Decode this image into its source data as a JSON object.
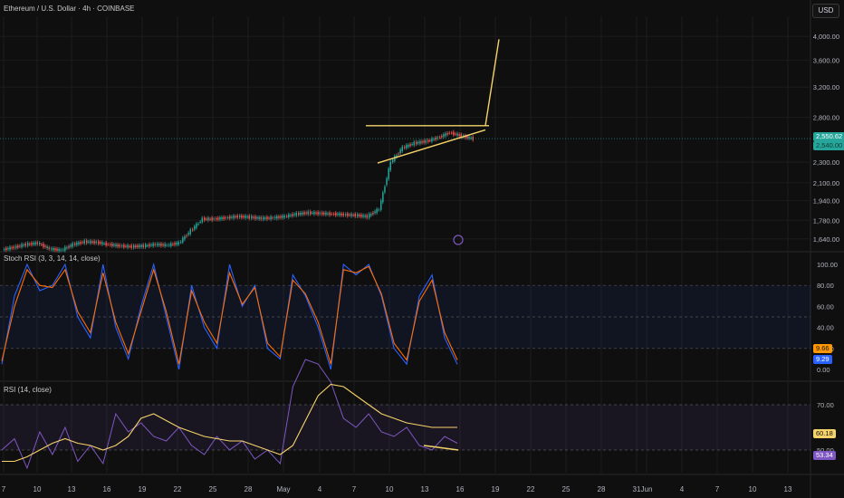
{
  "header": {
    "title": "Ethereum / U.S. Dollar · 4h · COINBASE",
    "currency_button": "USD"
  },
  "colors": {
    "background": "#0f0f0f",
    "grid": "#1c1c1c",
    "candle_up": "#26a69a",
    "candle_down": "#ef5350",
    "drawing": "#f5d36a",
    "stoch_k": "#2962ff",
    "stoch_d": "#ff6d00",
    "rsi": "#7e57c2",
    "rsi_ma": "#f5d36a",
    "price_line": "#26a69a"
  },
  "x_axis": {
    "labels": [
      "7",
      "10",
      "13",
      "16",
      "19",
      "22",
      "25",
      "28",
      "May",
      "4",
      "7",
      "10",
      "13",
      "16",
      "19",
      "22",
      "25",
      "28",
      "31",
      "Jun",
      "4",
      "7",
      "10",
      "13"
    ]
  },
  "price_axis": {
    "ticks": [
      "4,000.00",
      "3,600.00",
      "3,200.00",
      "2,800.00",
      "2,300.00",
      "2,100.00",
      "1,940.00",
      "1,780.00",
      "1,640.00"
    ],
    "current_price": "2,550.62",
    "current_sub": "2,540.00"
  },
  "stoch_rsi": {
    "label": "Stoch RSI (3, 3, 14, 14, close)",
    "ticks": [
      "100.00",
      "80.00",
      "60.00",
      "40.00",
      "20.00",
      "0.00"
    ],
    "k_value": "9.66",
    "d_value": "9.29"
  },
  "rsi": {
    "label": "RSI (14, close)",
    "ticks": [
      "70.00",
      "50.00"
    ],
    "value": "60.18",
    "ma_value": "53.34"
  },
  "chart_data": [
    {
      "type": "candlestick",
      "title": "Ethereum / U.S. Dollar · 4h · COINBASE",
      "y_scale": "log",
      "ylim": [
        1600,
        4200
      ],
      "series": [
        {
          "points": [
            [
              "Apr 7",
              1580
            ],
            [
              "Apr 8",
              1600
            ],
            [
              "Apr 9",
              1610
            ],
            [
              "Apr 10",
              1570
            ],
            [
              "Apr 11",
              1560
            ],
            [
              "Apr 12",
              1600
            ],
            [
              "Apr 13",
              1620
            ],
            [
              "Apr 14",
              1615
            ],
            [
              "Apr 15",
              1600
            ],
            [
              "Apr 16",
              1590
            ],
            [
              "Apr 17",
              1585
            ],
            [
              "Apr 18",
              1590
            ],
            [
              "Apr 19",
              1600
            ],
            [
              "Apr 20",
              1595
            ],
            [
              "Apr 21",
              1610
            ],
            [
              "Apr 22",
              1700
            ],
            [
              "Apr 23",
              1790
            ],
            [
              "Apr 24",
              1790
            ],
            [
              "Apr 25",
              1800
            ],
            [
              "Apr 26",
              1810
            ],
            [
              "Apr 27",
              1805
            ],
            [
              "Apr 28",
              1795
            ],
            [
              "Apr 29",
              1800
            ],
            [
              "Apr 30",
              1810
            ],
            [
              "May 1",
              1830
            ],
            [
              "May 2",
              1840
            ],
            [
              "May 3",
              1835
            ],
            [
              "May 4",
              1830
            ],
            [
              "May 5",
              1825
            ],
            [
              "May 6",
              1820
            ],
            [
              "May 7",
              1810
            ],
            [
              "May 8",
              1870
            ],
            [
              "May 9",
              2300
            ],
            [
              "May 10",
              2450
            ],
            [
              "May 11",
              2500
            ],
            [
              "May 12",
              2520
            ],
            [
              "May 13",
              2560
            ],
            [
              "May 14",
              2620
            ],
            [
              "May 15",
              2580
            ],
            [
              "May 16",
              2550
            ]
          ]
        }
      ],
      "drawings": {
        "horizontal_resistance": 2700,
        "rising_support": [
          [
            "May 8",
            2290
          ],
          [
            "May 17",
            2650
          ]
        ],
        "breakout_projection": [
          [
            "May 17",
            2700
          ],
          [
            "May 18",
            3950
          ]
        ]
      }
    },
    {
      "type": "line",
      "title": "Stoch RSI (3, 3, 14, 14, close)",
      "ylim": [
        0,
        100
      ],
      "bands": [
        20,
        50,
        80
      ],
      "series": [
        {
          "name": "K",
          "values": [
            5,
            70,
            100,
            75,
            80,
            100,
            50,
            30,
            100,
            40,
            10,
            60,
            100,
            50,
            0,
            80,
            40,
            20,
            100,
            60,
            80,
            20,
            10,
            90,
            70,
            40,
            0,
            100,
            90,
            100,
            70,
            20,
            5,
            70,
            90,
            30,
            5
          ]
        },
        {
          "name": "D",
          "values": [
            8,
            60,
            95,
            80,
            78,
            95,
            55,
            35,
            92,
            45,
            15,
            55,
            95,
            55,
            5,
            75,
            45,
            25,
            92,
            62,
            78,
            25,
            12,
            85,
            72,
            45,
            5,
            95,
            92,
            98,
            72,
            25,
            9,
            65,
            85,
            35,
            9
          ]
        }
      ]
    },
    {
      "type": "line",
      "title": "RSI (14, close)",
      "ylim": [
        40,
        80
      ],
      "bands": [
        50,
        70
      ],
      "series": [
        {
          "name": "RSI",
          "values": [
            50,
            55,
            42,
            58,
            48,
            60,
            45,
            52,
            44,
            66,
            58,
            62,
            56,
            54,
            60,
            52,
            48,
            56,
            50,
            54,
            46,
            50,
            44,
            78,
            90,
            88,
            80,
            64,
            60,
            66,
            58,
            56,
            60,
            52,
            50,
            56,
            53
          ]
        },
        {
          "name": "MA",
          "values": [
            45,
            45,
            47,
            50,
            53,
            55,
            53,
            52,
            50,
            52,
            56,
            64,
            66,
            63,
            60,
            58,
            56,
            55,
            54,
            54,
            52,
            50,
            48,
            52,
            63,
            74,
            79,
            78,
            74,
            70,
            66,
            64,
            62,
            61,
            60,
            60,
            60
          ]
        }
      ],
      "divergence_line": [
        [
          "May 15",
          52
        ],
        [
          "May 17",
          50
        ]
      ]
    }
  ]
}
